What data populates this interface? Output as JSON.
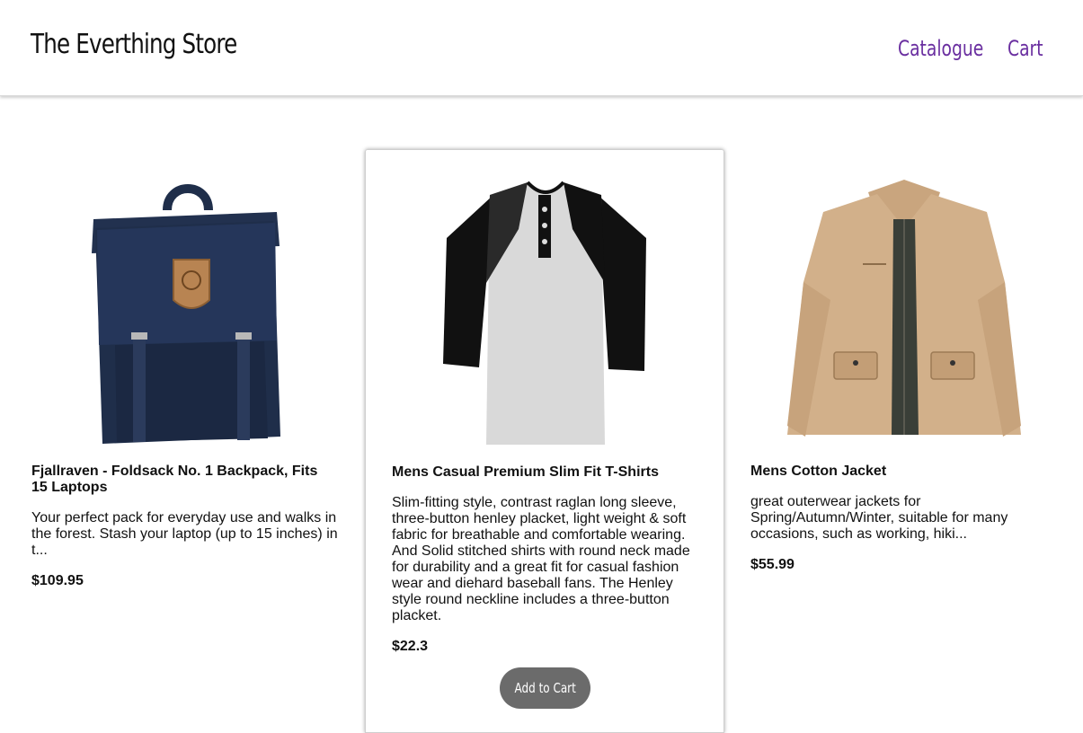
{
  "header": {
    "brand": "The Everthing Store",
    "nav": {
      "catalogue": "Catalogue",
      "cart": "Cart"
    },
    "nav_color": "#6a2fa0"
  },
  "products": [
    {
      "title": "Fjallraven - Foldsack No. 1 Backpack, Fits 15 Laptops",
      "description": "Your perfect pack for everyday use and walks in the forest. Stash your laptop (up to 15 inches) in t...",
      "price": "$109.95",
      "image": "backpack-image"
    },
    {
      "title": "Mens Casual Premium Slim Fit T-Shirts",
      "description": "Slim-fitting style, contrast raglan long sleeve, three-button henley placket, light weight & soft fabric for breathable and comfortable wearing. And Solid stitched shirts with round neck made for durability and a great fit for casual fashion wear and diehard baseball fans. The Henley style round neckline includes a three-button placket.",
      "price": "$22.3",
      "image": "tshirt-image",
      "add_to_cart": "Add to Cart"
    },
    {
      "title": "Mens Cotton Jacket",
      "description": "great outerwear jackets for Spring/Autumn/Winter, suitable for many occasions, such as working, hiki...",
      "price": "$55.99",
      "image": "jacket-image"
    }
  ],
  "colors": {
    "button_bg": "#6b6b6b",
    "backpack": "#1f2e4a",
    "jacket": "#d2b08a"
  }
}
